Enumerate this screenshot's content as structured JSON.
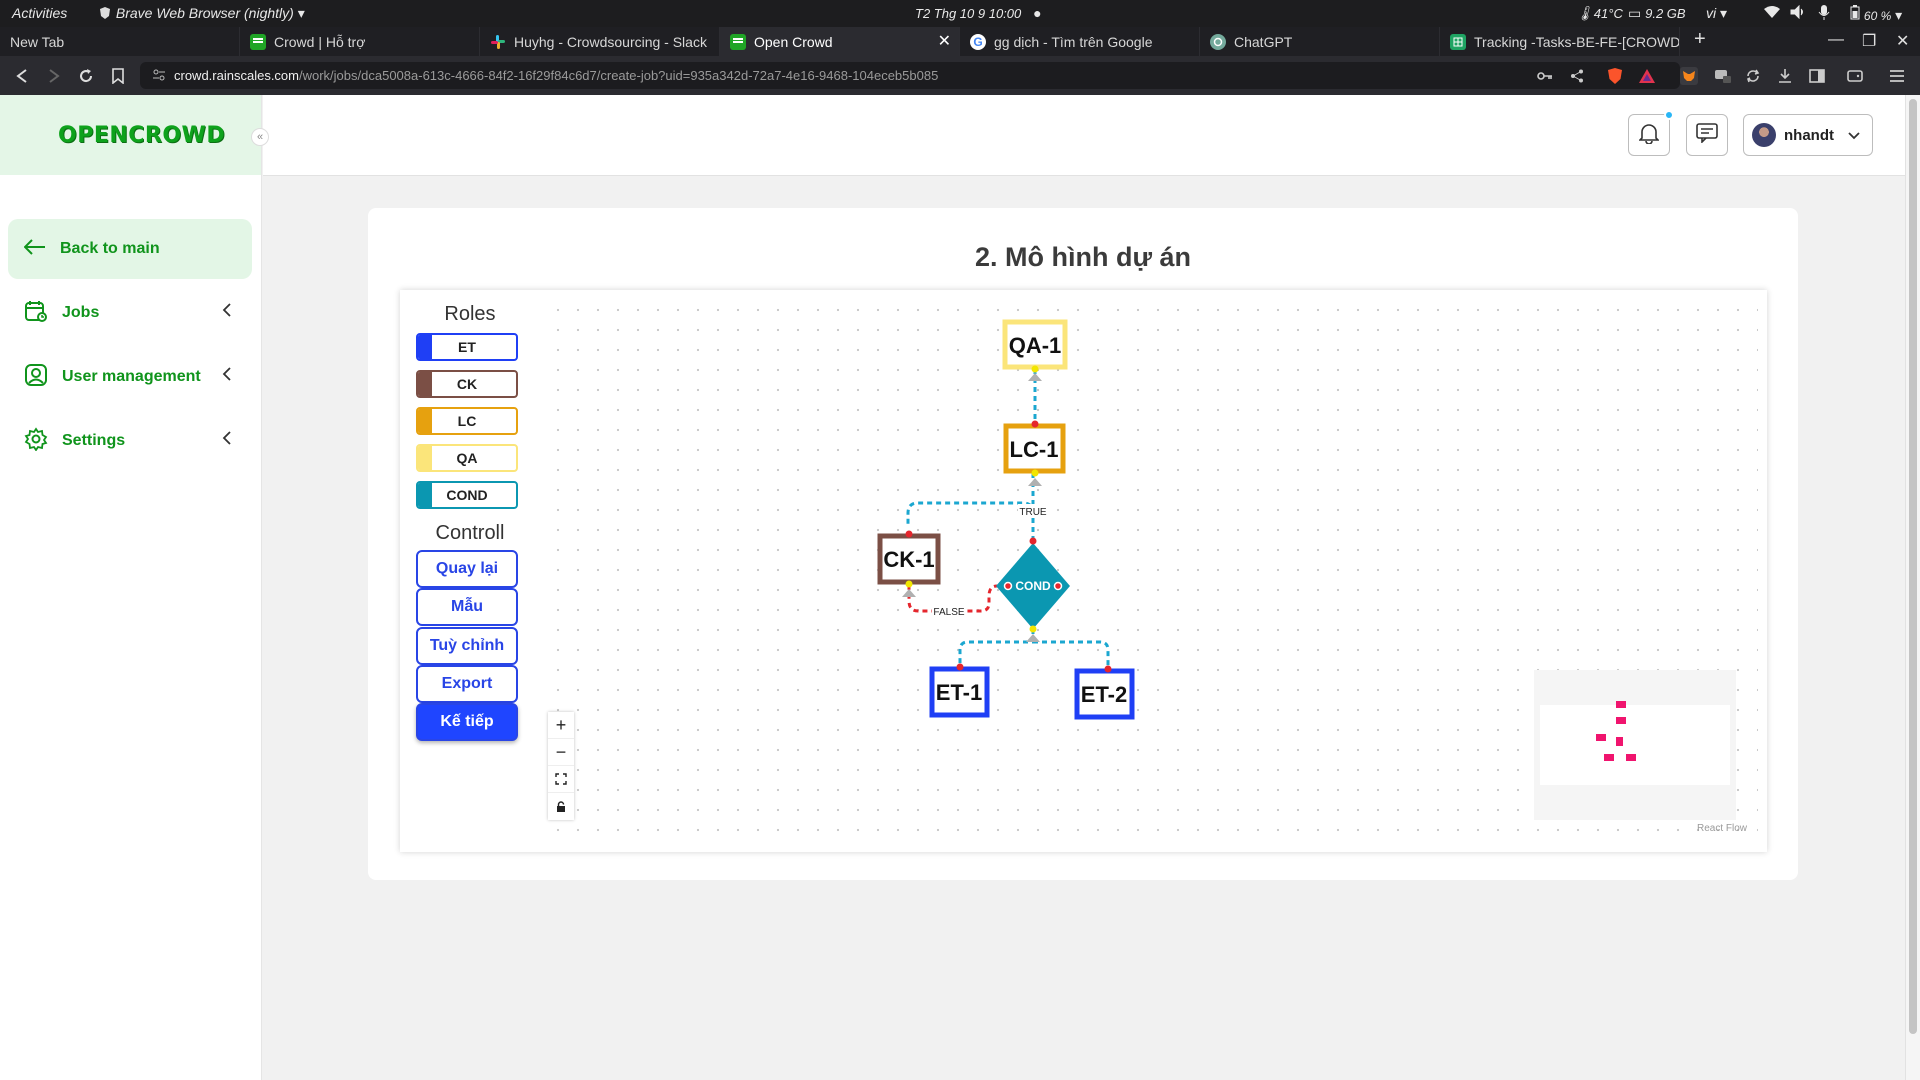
{
  "system_bar": {
    "activities": "Activities",
    "app_name": "Brave Web Browser (nightly)",
    "datetime": "T2 Thg 10 9  10:00",
    "temperature": "41°C",
    "memory": "9.2 GB",
    "language": "vi",
    "battery": "60 %"
  },
  "tabs": [
    {
      "label": "New Tab",
      "favicon": "none"
    },
    {
      "label": "Crowd | Hỗ trợ",
      "favicon": "opencrowd-favicon"
    },
    {
      "label": "Huyhg - Crowdsourcing - Slack",
      "favicon": "slack-favicon"
    },
    {
      "label": "Open Crowd",
      "favicon": "opencrowd-favicon",
      "active": true
    },
    {
      "label": "gg dịch - Tìm trên Google",
      "favicon": "google-favicon"
    },
    {
      "label": "ChatGPT",
      "favicon": "chatgpt-favicon"
    },
    {
      "label": "Tracking -Tasks-BE-FE-[CROWD] - Goo",
      "favicon": "sheets-favicon"
    }
  ],
  "address": {
    "host": "crowd.rainscales.com",
    "path": "/work/jobs/dca5008a-613c-4666-84f2-16f29f84c6d7/create-job?uid=935a342d-72a7-4e16-9468-104eceb5b085"
  },
  "sidebar": {
    "brand": "OPENCROWD",
    "collapse_icon": "«",
    "items": [
      {
        "label": "Back to main",
        "icon": "arrow-left-icon",
        "active": true
      },
      {
        "label": "Jobs",
        "icon": "jobs-icon"
      },
      {
        "label": "User management",
        "icon": "user-icon"
      },
      {
        "label": "Settings",
        "icon": "gear-icon"
      }
    ]
  },
  "header": {
    "username": "nhandt"
  },
  "card": {
    "title": "2. Mô hình dự án"
  },
  "roles_panel": {
    "title": "Roles",
    "roles": [
      {
        "label": "ET",
        "color": "#1f3ff5"
      },
      {
        "label": "CK",
        "color": "#7b4f45"
      },
      {
        "label": "LC",
        "color": "#e6a10f"
      },
      {
        "label": "QA",
        "color": "#fbe57a"
      },
      {
        "label": "COND",
        "color": "#0b97b1"
      }
    ]
  },
  "control_panel": {
    "title": "Controll",
    "buttons": [
      "Quay lại",
      "Mẫu",
      "Tuỳ chỉnh",
      "Export",
      "Kế tiếp"
    ]
  },
  "flow": {
    "nodes": [
      {
        "id": "QA-1",
        "role": "QA"
      },
      {
        "id": "LC-1",
        "role": "LC"
      },
      {
        "id": "CK-1",
        "role": "CK"
      },
      {
        "id": "COND",
        "role": "COND"
      },
      {
        "id": "ET-1",
        "role": "ET"
      },
      {
        "id": "ET-2",
        "role": "ET"
      }
    ],
    "edges": [
      {
        "from": "LC-1",
        "to": "QA-1"
      },
      {
        "from": "COND",
        "to": "LC-1",
        "label": "TRUE"
      },
      {
        "from": "COND",
        "to": "CK-1",
        "label": "FALSE"
      },
      {
        "from": "ET-1",
        "to": "COND"
      },
      {
        "from": "ET-2",
        "to": "COND"
      }
    ],
    "edge_label_true": "TRUE",
    "edge_label_false": "FALSE",
    "attribution": "React Flow"
  },
  "colors": {
    "brand_green": "#10941c",
    "primary_blue": "#1f45ff",
    "edge_blue": "#1ba7d0",
    "edge_red": "#e5262d"
  }
}
